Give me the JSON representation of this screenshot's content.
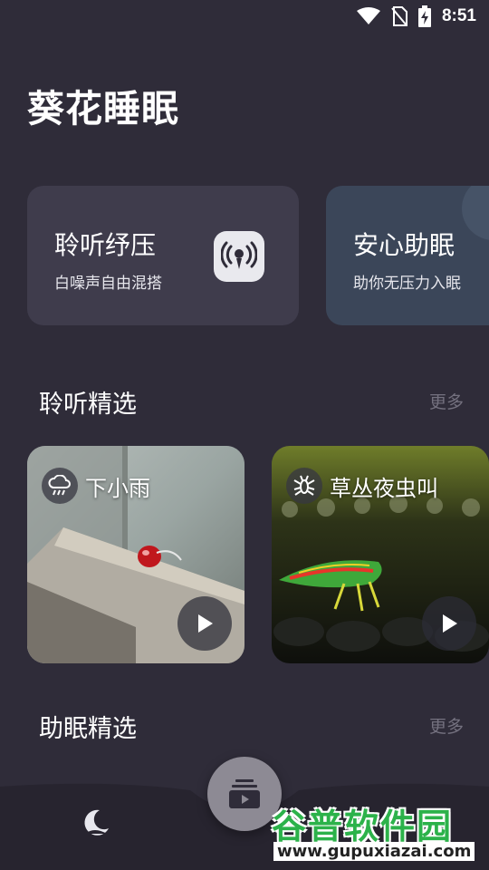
{
  "status_bar": {
    "time": "8:51",
    "icons": [
      "wifi-icon",
      "no-sim-icon",
      "battery-charging-icon"
    ]
  },
  "app": {
    "title": "葵花睡眠"
  },
  "feature_cards": [
    {
      "title": "聆听纾压",
      "subtitle": "白噪声自由混搭",
      "icon": "broadcast-icon"
    },
    {
      "title": "安心助眠",
      "subtitle": "助你无压力入眠"
    }
  ],
  "sections": {
    "listen": {
      "title": "聆听精选",
      "more": "更多"
    },
    "sleep": {
      "title": "助眠精选",
      "more": "更多"
    }
  },
  "sound_cards": [
    {
      "label": "下小雨",
      "icon": "rain-cloud-icon"
    },
    {
      "label": "草丛夜虫叫",
      "icon": "insect-icon"
    }
  ],
  "bottom_nav": {
    "items": [
      "sleep-moon-icon",
      "playlist-icon"
    ]
  },
  "watermark": {
    "brand": "谷普软件园",
    "url": "www.gupuxiazai.com"
  },
  "colors": {
    "background": "#2f2c39",
    "card_relax": "#3f3c4c",
    "card_sleep": "#3b4659",
    "more_text": "#74717f"
  }
}
